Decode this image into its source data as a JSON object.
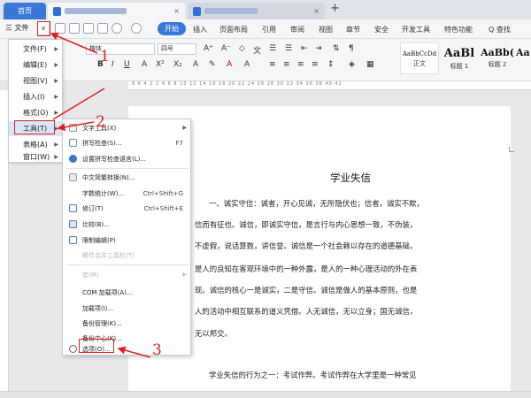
{
  "tabbar": {
    "home_label": "首页",
    "plus_label": "+",
    "close_label": "×"
  },
  "toolbar": {
    "menu_label": "三 文件",
    "dropdown_label": "∨",
    "start_label": "开始"
  },
  "ribbon_tabs": [
    "插入",
    "页面布局",
    "引用",
    "审阅",
    "视图",
    "章节",
    "安全",
    "开发工具",
    "特色功能",
    "Q 查找"
  ],
  "ribbon": {
    "font_name": "楷体",
    "font_size": "四号",
    "format_brush": "格式刷",
    "styles": [
      {
        "sample": "AaBbCcDd",
        "name": "正文"
      },
      {
        "sample": "AaBl",
        "name": "标题 1"
      },
      {
        "sample": "AaBb(",
        "name": "标题 2"
      },
      {
        "sample": "AaBb",
        "name": "标题 3"
      }
    ]
  },
  "ruler_text": "8 6 4 2 2 4 6 8 10 12 14 16 18 20 22 24 26 28 30 32 34 36 38 40 42",
  "document": {
    "title": "学业失信",
    "lines": [
      "一、诚实守信：诚者，开心见诚，无所隐伏也；信者，诚实不欺，",
      "信而有征也。诚信，即诚实守信，是言行与内心思想一致，不伪装，",
      "不虚假，说话算数，讲信誉。诚信是一个社会赖以存在的道德基础，",
      "是人的良知在客观环境中的一种外露，是人的一种心理活动的外在表",
      "现。诚信的核心一是诚实，二是守信。诚信是做人的基本原则，也是",
      "人的活动中相互联系的道义凭借。人无诚信，无以立身；国无诚信，",
      "无以邦交。",
      "学业失信的行为之一：考试作弊。考试作弊在大学里是一种常见"
    ]
  },
  "menu1": {
    "items": [
      {
        "label": "文件(F)"
      },
      {
        "label": "编辑(E)"
      },
      {
        "label": "视图(V)"
      },
      {
        "label": "插入(I)"
      },
      {
        "label": "格式(O)"
      },
      {
        "label": "工具(T)"
      },
      {
        "label": "表格(A)"
      },
      {
        "label": "窗口(W)"
      }
    ]
  },
  "menu2": {
    "items": [
      {
        "label": "文字工具(X)",
        "shortcut": ""
      },
      {
        "label": "拼写检查(S)...",
        "shortcut": "F7"
      },
      {
        "label": "设置拼写检查语言(L)...",
        "shortcut": ""
      },
      {
        "label": "中文简繁转换(N)...",
        "shortcut": ""
      },
      {
        "label": "字数统计(W)...",
        "shortcut": "Ctrl+Shift+G"
      },
      {
        "label": "修订(T)",
        "shortcut": "Ctrl+Shift+E"
      },
      {
        "label": "比较(B)...",
        "shortcut": ""
      },
      {
        "label": "限制编辑(P)",
        "shortcut": ""
      },
      {
        "label": "邮件合并工具栏(T)",
        "shortcut": ""
      },
      {
        "label": "宏(M)",
        "shortcut": ""
      },
      {
        "label": "COM 加载项(A)...",
        "shortcut": ""
      },
      {
        "label": "加载项(I)...",
        "shortcut": ""
      },
      {
        "label": "备份管理(K)...",
        "shortcut": ""
      },
      {
        "label": "备份中心(K)...",
        "shortcut": ""
      },
      {
        "label": "选项(O)...",
        "shortcut": ""
      }
    ]
  },
  "annotations": {
    "step1": "1",
    "step2": "2",
    "step3": "3"
  },
  "colors": {
    "accent": "#3a78d8",
    "highlight": "#e02020"
  }
}
